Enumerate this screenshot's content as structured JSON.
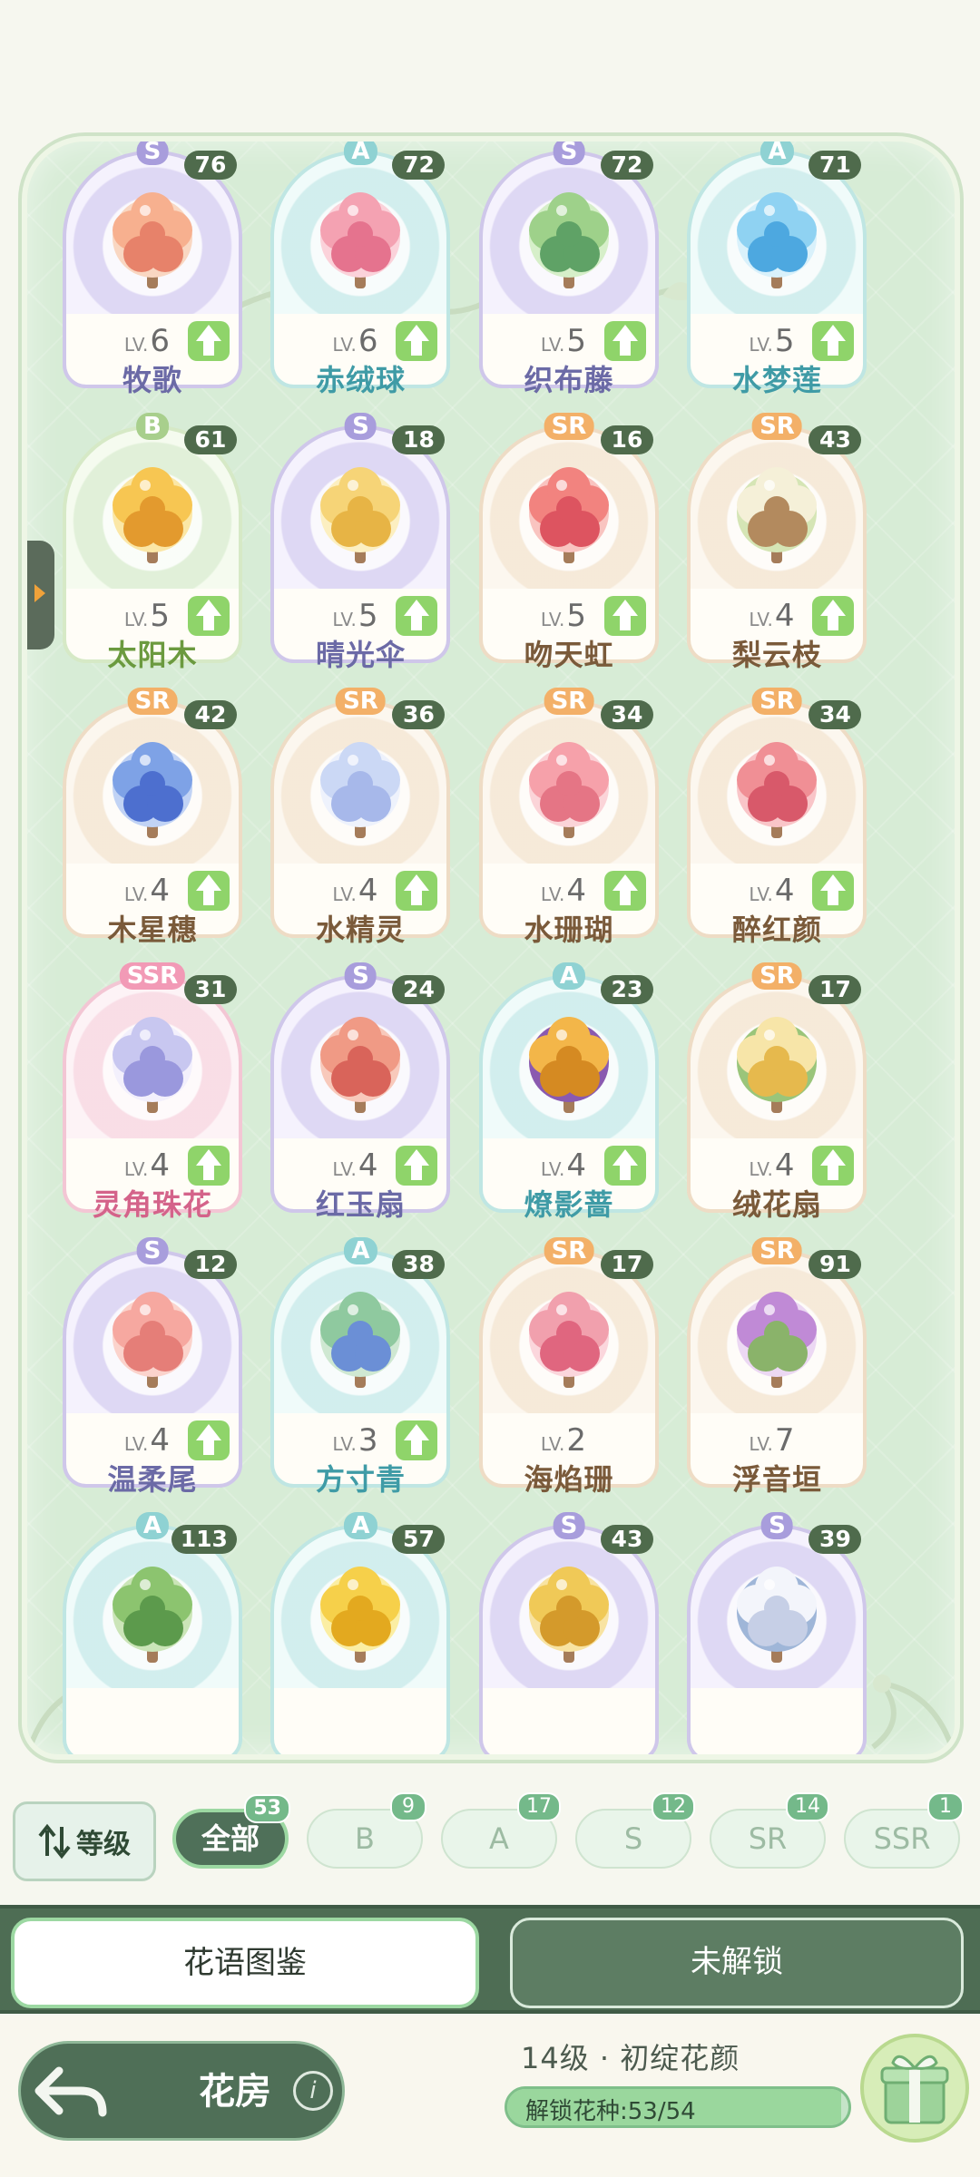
{
  "panel": {
    "cards": [
      {
        "grade": "S",
        "count": "76",
        "level": "6",
        "name": "牧歌",
        "upgrade": true,
        "flower": "peach-blossom-tree",
        "colors": [
          "#f7b08f",
          "#e7826a",
          "#f9d7c2"
        ]
      },
      {
        "grade": "A",
        "count": "72",
        "level": "6",
        "name": "赤绒球",
        "upgrade": true,
        "flower": "pink-hydrangea",
        "colors": [
          "#f4a2b2",
          "#e5738e",
          "#fbd2da"
        ]
      },
      {
        "grade": "S",
        "count": "72",
        "level": "5",
        "name": "织布藤",
        "upgrade": true,
        "flower": "green-vine",
        "colors": [
          "#9ed18a",
          "#5fa266",
          "#d6efc9"
        ]
      },
      {
        "grade": "A",
        "count": "71",
        "level": "5",
        "name": "水梦莲",
        "upgrade": true,
        "flower": "blue-lotus",
        "colors": [
          "#8fd2f2",
          "#4da8e0",
          "#d9f1fb"
        ]
      },
      {
        "grade": "B",
        "count": "61",
        "level": "5",
        "name": "太阳木",
        "upgrade": true,
        "flower": "sunflower-tree",
        "colors": [
          "#f7c652",
          "#e39a2e",
          "#fbe7a6"
        ]
      },
      {
        "grade": "S",
        "count": "18",
        "level": "5",
        "name": "晴光伞",
        "upgrade": true,
        "flower": "jellyfish-umbrella",
        "colors": [
          "#f6d477",
          "#e7b445",
          "#fcefc1"
        ]
      },
      {
        "grade": "SR",
        "count": "16",
        "level": "5",
        "name": "吻天虹",
        "upgrade": true,
        "flower": "red-balloons",
        "colors": [
          "#f2837f",
          "#dd5460",
          "#f9c4c0"
        ]
      },
      {
        "grade": "SR",
        "count": "43",
        "level": "4",
        "name": "梨云枝",
        "upgrade": true,
        "flower": "white-lily-lantern",
        "colors": [
          "#f5f0d8",
          "#b38a5e",
          "#d5e5b5"
        ]
      },
      {
        "grade": "SR",
        "count": "42",
        "level": "4",
        "name": "木星穗",
        "upgrade": true,
        "flower": "blue-hydrangea",
        "colors": [
          "#7ea2e6",
          "#4d6fcf",
          "#c1d3f5"
        ]
      },
      {
        "grade": "SR",
        "count": "36",
        "level": "4",
        "name": "水精灵",
        "upgrade": true,
        "flower": "bubble-flowers",
        "colors": [
          "#cbd8f5",
          "#a7b8ea",
          "#eef2fc"
        ]
      },
      {
        "grade": "SR",
        "count": "34",
        "level": "4",
        "name": "水珊瑚",
        "upgrade": true,
        "flower": "pink-coral",
        "colors": [
          "#f6a1aa",
          "#e57585",
          "#fbd4d8"
        ]
      },
      {
        "grade": "SR",
        "count": "34",
        "level": "4",
        "name": "醉红颜",
        "upgrade": true,
        "flower": "red-peony",
        "colors": [
          "#f08f95",
          "#d8596a",
          "#f9c5c8"
        ]
      },
      {
        "grade": "SSR",
        "count": "31",
        "level": "4",
        "name": "灵角珠花",
        "upgrade": true,
        "flower": "unicorn-arch",
        "colors": [
          "#c8c7f0",
          "#9a98dd",
          "#f3f0fc"
        ]
      },
      {
        "grade": "S",
        "count": "24",
        "level": "4",
        "name": "红玉扇",
        "upgrade": true,
        "flower": "coral-fan-tree",
        "colors": [
          "#f09a85",
          "#d9645a",
          "#f8c9bb"
        ]
      },
      {
        "grade": "A",
        "count": "23",
        "level": "4",
        "name": "燎影蔷",
        "upgrade": true,
        "flower": "golden-roses",
        "colors": [
          "#f3b649",
          "#d58a22",
          "#8a5ab0"
        ]
      },
      {
        "grade": "SR",
        "count": "17",
        "level": "4",
        "name": "绒花扇",
        "upgrade": true,
        "flower": "cream-fan-flowers",
        "colors": [
          "#f7e5a8",
          "#e6b94d",
          "#9ac57a"
        ]
      },
      {
        "grade": "S",
        "count": "12",
        "level": "4",
        "name": "温柔尾",
        "upgrade": true,
        "flower": "pink-fluffy-tails",
        "colors": [
          "#f6a8a0",
          "#e57e78",
          "#fbd3cc"
        ]
      },
      {
        "grade": "A",
        "count": "38",
        "level": "3",
        "name": "方寸青",
        "upgrade": true,
        "flower": "green-blue-bush",
        "colors": [
          "#8fc99f",
          "#6b8fd6",
          "#cfe8d2"
        ]
      },
      {
        "grade": "SR",
        "count": "17",
        "level": "2",
        "name": "海焰珊",
        "upgrade": false,
        "flower": "pink-coral-flame",
        "colors": [
          "#f1a0ad",
          "#e0667f",
          "#fbd6dc"
        ]
      },
      {
        "grade": "SR",
        "count": "91",
        "level": "7",
        "name": "浮音垣",
        "upgrade": false,
        "flower": "purple-flower-arch",
        "colors": [
          "#c08ad6",
          "#8ab36a",
          "#ecd8f3"
        ]
      },
      {
        "grade": "A",
        "count": "113",
        "level": "",
        "name": "",
        "upgrade": false,
        "flower": "green-leaf-plant",
        "colors": [
          "#8cc46f",
          "#5c9a4c",
          "#cbe5b8"
        ]
      },
      {
        "grade": "A",
        "count": "57",
        "level": "",
        "name": "",
        "upgrade": false,
        "flower": "yellow-flower-tree",
        "colors": [
          "#f6d04a",
          "#e3a91f",
          "#fbeea3"
        ]
      },
      {
        "grade": "S",
        "count": "43",
        "level": "",
        "name": "",
        "upgrade": false,
        "flower": "wheat-bundle",
        "colors": [
          "#f0c957",
          "#d49a2b",
          "#f8e3a2"
        ]
      },
      {
        "grade": "S",
        "count": "39",
        "level": "",
        "name": "",
        "upgrade": false,
        "flower": "white-cotton",
        "colors": [
          "#f3f5fb",
          "#c6cfe6",
          "#9fb6d8"
        ]
      }
    ],
    "level_prefix": "LV."
  },
  "filters": {
    "sort_label": "等级",
    "items": [
      {
        "label": "全部",
        "badge": "53",
        "active": true
      },
      {
        "label": "B",
        "badge": "9",
        "active": false
      },
      {
        "label": "A",
        "badge": "17",
        "active": false
      },
      {
        "label": "S",
        "badge": "12",
        "active": false
      },
      {
        "label": "SR",
        "badge": "14",
        "active": false
      },
      {
        "label": "SSR",
        "badge": "1",
        "active": false
      }
    ]
  },
  "tabs": {
    "catalog": "花语图鉴",
    "locked": "未解锁"
  },
  "bottom": {
    "house_title": "花房",
    "info_icon": "i",
    "level_title": "14级 · 初绽花颜",
    "progress_text": "解锁花种:53/54",
    "progress_fraction": 0.98
  }
}
